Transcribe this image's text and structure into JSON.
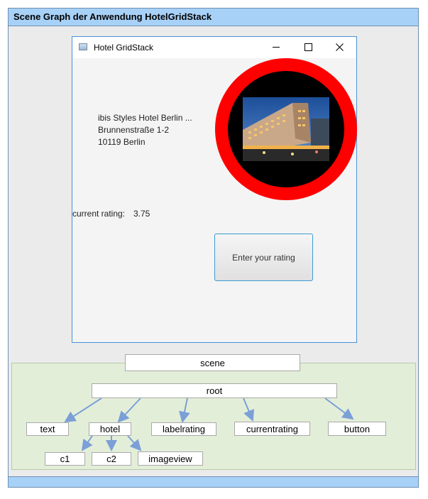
{
  "header": {
    "title": "Scene Graph der Anwendung HotelGridStack"
  },
  "window": {
    "title": "Hotel GridStack",
    "hotel_name": "ibis Styles Hotel Berlin ...",
    "street": "Brunnenstraße 1-2",
    "city": "10119 Berlin",
    "rating_label": "current rating:",
    "rating_value": "3.75",
    "button_label": "Enter your rating"
  },
  "scene_graph": {
    "scene": "scene",
    "root": "root",
    "children": [
      "text",
      "hotel",
      "labelrating",
      "currentrating",
      "button"
    ],
    "hotel_children": [
      "c1",
      "c2",
      "imageview"
    ],
    "edge_color": "#7b9fd6"
  },
  "colors": {
    "title_bar": "#a8d1f7",
    "graph_panel": "#e3eed9",
    "ring": "#ff0000"
  }
}
